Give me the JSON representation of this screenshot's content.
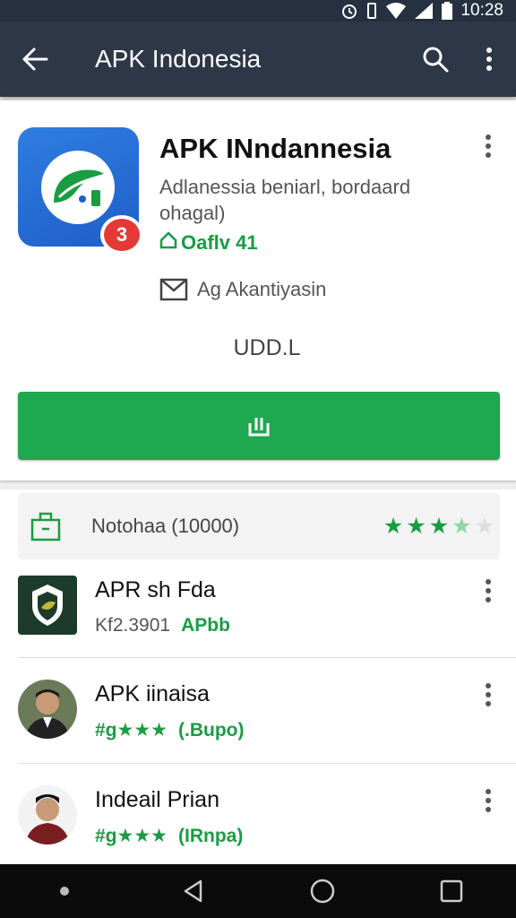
{
  "status_bar": {
    "time": "10:28"
  },
  "app_bar": {
    "title": "APK Indonesia"
  },
  "app": {
    "title": "APK INndannesia",
    "subtitle": "Adlanessia beniarl, bordaard ohagal)",
    "badge": "3",
    "rating_text": "Oaflv 41",
    "contact": "Ag Akantiyasin",
    "size": "UDD.L"
  },
  "notification_row": {
    "label": "Notohaa (10000)",
    "rating": 3.5
  },
  "list_items": [
    {
      "name": "APR sh Fda",
      "meta1": "Kf2.3901",
      "meta2": "APbb"
    },
    {
      "name": "APK iinaisa",
      "meta1": "#g",
      "meta2": "(.Bupo)",
      "stars": 3
    },
    {
      "name": "Indeail Prian",
      "meta1": "#g",
      "meta2": "(IRnpa)",
      "stars": 3
    }
  ],
  "colors": {
    "app_bar": "#2d3748",
    "install_green": "#1fa84f",
    "rating_green": "#1a9c43",
    "badge_red": "#e53935",
    "icon_blue": "#2f7de1"
  },
  "icons": {
    "back": "arrow-left-icon",
    "search": "search-icon",
    "more": "more-vert-icon",
    "install": "download-icon",
    "contact": "mail-icon",
    "notification": "shopping-bag-icon"
  }
}
